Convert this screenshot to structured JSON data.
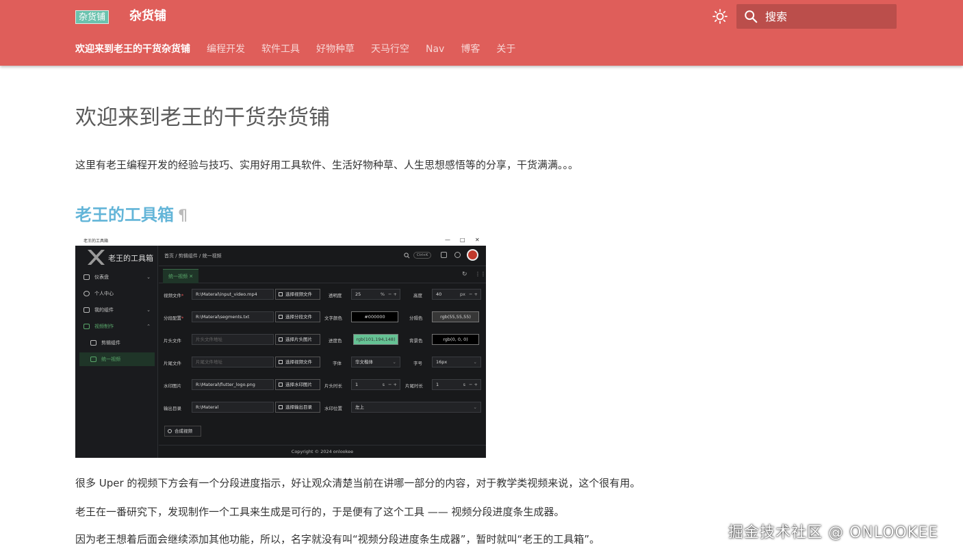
{
  "header": {
    "logo_text": "杂货铺",
    "site_title": "杂货铺",
    "search_placeholder": "搜索",
    "tabs": [
      {
        "label": "欢迎来到老王的干货杂货铺"
      },
      {
        "label": "编程开发"
      },
      {
        "label": "软件工具"
      },
      {
        "label": "好物种草"
      },
      {
        "label": "天马行空"
      },
      {
        "label": "Nav"
      },
      {
        "label": "博客"
      },
      {
        "label": "关于"
      }
    ]
  },
  "content": {
    "title": "欢迎来到老王的干货杂货铺",
    "intro": "这里有老王编程开发的经验与技巧、实用好用工具软件、生活好物种草、人生思想感悟等的分享，干货满满。。。",
    "section_heading": "老王的工具箱",
    "permalink": "¶",
    "paragraphs": [
      "很多 Uper 的视频下方会有一个分段进度指示，好让观众清楚当前在讲哪一部分的内容，对于教学类视频来说，这个很有用。",
      "老王在一番研究下，发现制作一个工具来生成是可行的，于是便有了这个工具 —— 视频分段进度条生成器。",
      "因为老王想着后面会继续添加其他功能，所以，名字就没有叫“视频分段进度条生成器”，暂时就叫“老王的工具箱”。"
    ]
  },
  "screenshot": {
    "window_title": "老王的工具箱",
    "app_name": "老王的工具箱",
    "sidebar": [
      {
        "label": "仪表盘"
      },
      {
        "label": "个人中心"
      },
      {
        "label": "我的组件"
      },
      {
        "label": "视频制作"
      },
      {
        "label": "剪辑组件"
      },
      {
        "label": "统一视频"
      }
    ],
    "breadcrumb": "首页  /  剪辑组件  /  统一视频",
    "shortcut": "Ctrl+K",
    "active_tab": "统一视频",
    "form": {
      "video_label": "视频文件",
      "video_value": "R:\\Materal\\input_video.mp4",
      "video_btn": "选择视频文件",
      "opacity_label": "透明度",
      "opacity_value": "25",
      "opacity_unit": "%",
      "height_label": "高度",
      "height_value": "40",
      "height_unit": "px",
      "segments_label": "分段配置",
      "segments_value": "R:\\Materal\\segments.txt",
      "segments_btn": "选择分段文件",
      "text_color_label": "文字颜色",
      "text_color_value": "#000000",
      "divider_color_label": "分隔色",
      "divider_color_value": "rgb(55,55,55)",
      "intro_label": "片头文件",
      "intro_placeholder": "片头文件地址",
      "intro_btn": "选择片头图片",
      "progress_color_label": "进度色",
      "progress_color_value": "rgb(101,194,148)",
      "bg_color_label": "背景色",
      "bg_color_value": "rgb(0, 0, 0)",
      "outro_label": "片尾文件",
      "outro_placeholder": "片尾文件地址",
      "outro_btn": "选择视频文件",
      "font_label": "字体",
      "font_value": "华文楷体",
      "font_size_label": "字号",
      "font_size_value": "16px",
      "watermark_label": "水印图片",
      "watermark_value": "R:\\Materal\\flutter_logo.png",
      "watermark_btn": "选择水印图片",
      "intro_dur_label": "片头时长",
      "intro_dur_value": "1",
      "outro_dur_label": "片尾时长",
      "outro_dur_value": "1",
      "dur_unit": "s",
      "output_label": "输出目录",
      "output_value": "R:\\Materal",
      "output_btn": "选择输出目录",
      "wm_pos_label": "水印位置",
      "wm_pos_value": "左上",
      "generate_btn": "合成视频"
    },
    "footer": "Copyright © 2024 onlookee",
    "colors": {
      "progress": "#65c294",
      "accent": "#5aa86b"
    }
  },
  "watermark": "掘金技术社区 @ ONLOOKEE",
  "colors": {
    "header_bg": "#df5e5a",
    "heading_blue": "#63b5d8"
  }
}
